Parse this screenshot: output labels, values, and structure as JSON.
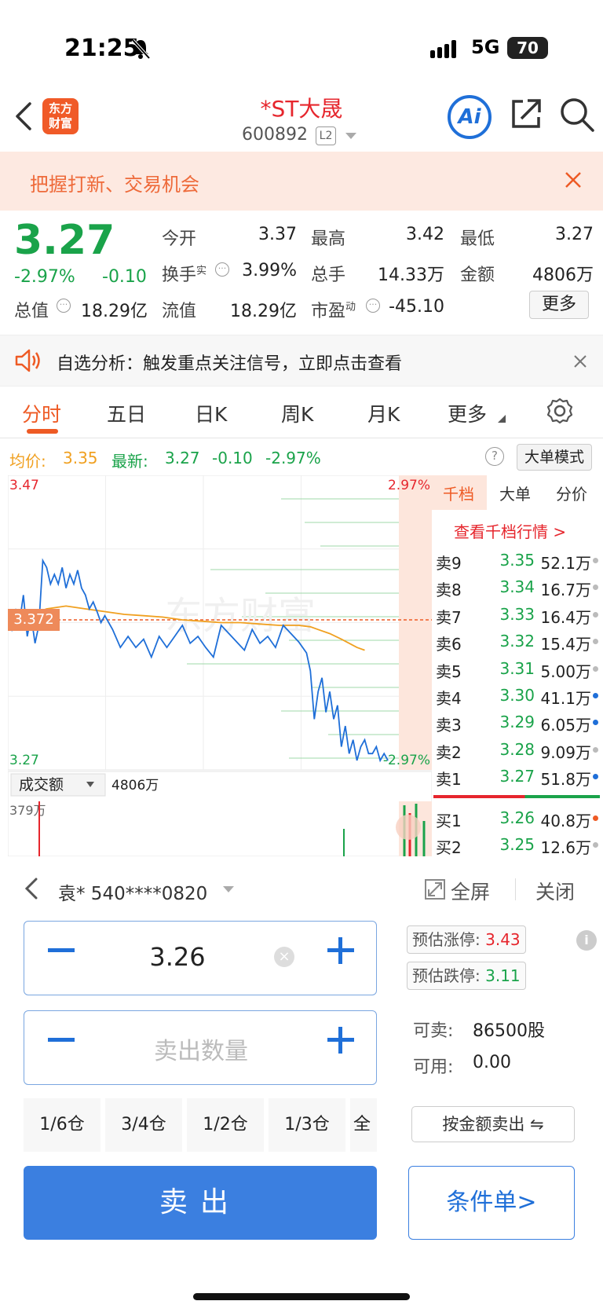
{
  "status": {
    "time": "21:25",
    "network": "5G",
    "battery": "70"
  },
  "header": {
    "logo": "东方\n财富",
    "title": "*ST大晟",
    "code": "600892",
    "level": "L2",
    "ai": "Ai"
  },
  "banner": {
    "text": "把握打新、交易机会"
  },
  "quote": {
    "price": "3.27",
    "pct": "-2.97%",
    "chg": "-0.10",
    "open_label": "今开",
    "open": "3.37",
    "high_label": "最高",
    "high": "3.42",
    "low_label": "最低",
    "low": "3.27",
    "turnover_label": "换手",
    "turnover_sup": "实",
    "turnover": "3.99%",
    "volume_label": "总手",
    "volume": "14.33万",
    "amount_label": "金额",
    "amount": "4806万",
    "mktcap_label": "总值",
    "mktcap": "18.29亿",
    "float_label": "流值",
    "float": "18.29亿",
    "pe_label": "市盈",
    "pe_sup": "动",
    "pe": "-45.10",
    "more": "更多"
  },
  "alert": {
    "text": "自选分析：触发重点关注信号，立即点击查看"
  },
  "tabs": [
    "分时",
    "五日",
    "日K",
    "周K",
    "月K",
    "更多"
  ],
  "chart_info": {
    "avg_label": "均价:",
    "avg": "3.35",
    "last_label": "最新:",
    "last": "3.27",
    "chg": "-0.10",
    "pct": "-2.97%",
    "mode": "大单模式"
  },
  "chart_data": {
    "type": "line",
    "y_top": "3.47",
    "y_bottom": "3.27",
    "pct_top": "2.97%",
    "pct_bottom": "-2.97%",
    "ylim": [
      3.27,
      3.47
    ],
    "ref_price": "3.372",
    "series": [],
    "price_x": [
      0,
      0.01,
      0.02,
      0.03,
      0.04,
      0.05,
      0.06,
      0.07,
      0.08,
      0.09,
      0.1,
      0.11,
      0.12,
      0.13,
      0.14,
      0.15,
      0.16,
      0.17,
      0.18,
      0.19,
      0.2,
      0.21,
      0.22,
      0.23,
      0.24,
      0.25,
      0.27,
      0.29,
      0.31,
      0.33,
      0.35,
      0.37,
      0.39,
      0.41,
      0.43,
      0.45,
      0.47,
      0.49,
      0.51,
      0.53,
      0.55,
      0.57,
      0.59,
      0.61,
      0.63,
      0.65,
      0.67,
      0.69,
      0.71,
      0.73,
      0.75,
      0.77,
      0.78,
      0.79,
      0.8,
      0.81,
      0.82,
      0.83,
      0.84,
      0.85,
      0.86,
      0.87,
      0.88,
      0.89,
      0.9,
      0.91,
      0.92,
      0.93,
      0.94,
      0.95,
      0.96,
      0.97,
      0.98
    ],
    "price_y": [
      3.372,
      3.365,
      3.38,
      3.37,
      3.39,
      3.36,
      3.375,
      3.355,
      3.368,
      3.415,
      3.41,
      3.398,
      3.405,
      3.398,
      3.41,
      3.395,
      3.405,
      3.398,
      3.408,
      3.395,
      3.39,
      3.38,
      3.385,
      3.378,
      3.37,
      3.375,
      3.365,
      3.352,
      3.36,
      3.352,
      3.358,
      3.345,
      3.36,
      3.352,
      3.36,
      3.368,
      3.355,
      3.36,
      3.352,
      3.345,
      3.368,
      3.362,
      3.356,
      3.35,
      3.365,
      3.355,
      3.36,
      3.352,
      3.368,
      3.362,
      3.356,
      3.348,
      3.335,
      3.3,
      3.32,
      3.33,
      3.305,
      3.32,
      3.3,
      3.31,
      3.28,
      3.295,
      3.275,
      3.285,
      3.27,
      3.28,
      3.285,
      3.275,
      3.275,
      3.28,
      3.27,
      3.275,
      3.27
    ],
    "avg_x": [
      0,
      0.05,
      0.1,
      0.15,
      0.2,
      0.25,
      0.3,
      0.35,
      0.4,
      0.45,
      0.5,
      0.55,
      0.6,
      0.65,
      0.7,
      0.75,
      0.78,
      0.8,
      0.83,
      0.86,
      0.88,
      0.9,
      0.92
    ],
    "avg_y": [
      3.37,
      3.375,
      3.38,
      3.382,
      3.38,
      3.378,
      3.376,
      3.375,
      3.374,
      3.372,
      3.371,
      3.37,
      3.37,
      3.369,
      3.368,
      3.368,
      3.367,
      3.365,
      3.362,
      3.358,
      3.355,
      3.352,
      3.35
    ],
    "volume_label": "成交额",
    "volume_value": "4806万",
    "volume_max": "379万"
  },
  "book": {
    "tabs": [
      "千档",
      "大单",
      "分价"
    ],
    "link": "查看千档行情 >",
    "asks": [
      {
        "label": "卖9",
        "price": "3.35",
        "vol": "52.1万",
        "dot": "#bbbbbb"
      },
      {
        "label": "卖8",
        "price": "3.34",
        "vol": "16.7万",
        "dot": "#bbbbbb"
      },
      {
        "label": "卖7",
        "price": "3.33",
        "vol": "16.4万",
        "dot": "#bbbbbb"
      },
      {
        "label": "卖6",
        "price": "3.32",
        "vol": "15.4万",
        "dot": "#bbbbbb"
      },
      {
        "label": "卖5",
        "price": "3.31",
        "vol": "5.00万",
        "dot": "#bbbbbb"
      },
      {
        "label": "卖4",
        "price": "3.30",
        "vol": "41.1万",
        "dot": "#1f6fd8"
      },
      {
        "label": "卖3",
        "price": "3.29",
        "vol": "6.05万",
        "dot": "#1f6fd8"
      },
      {
        "label": "卖2",
        "price": "3.28",
        "vol": "9.09万",
        "dot": "#bbbbbb"
      },
      {
        "label": "卖1",
        "price": "3.27",
        "vol": "51.8万",
        "dot": "#1f6fd8"
      }
    ],
    "bids": [
      {
        "label": "买1",
        "price": "3.26",
        "vol": "40.8万",
        "dot": "#ee5a24"
      },
      {
        "label": "买2",
        "price": "3.25",
        "vol": "12.6万",
        "dot": "#bbbbbb"
      }
    ]
  },
  "trade": {
    "account": "袁* 540****0820",
    "fullscreen": "全屏",
    "close": "关闭",
    "price": "3.26",
    "qty_placeholder": "卖出数量",
    "limit_up_label": "预估涨停:",
    "limit_up": "3.43",
    "limit_down_label": "预估跌停:",
    "limit_down": "3.11",
    "sellable_label": "可卖:",
    "sellable": "86500股",
    "avail_label": "可用:",
    "avail": "0.00",
    "by_amount": "按金额卖出 ⇋",
    "positions": [
      "1/6仓",
      "3/4仓",
      "1/2仓",
      "1/3仓",
      "全"
    ],
    "sell": "卖出",
    "cond": "条件单>"
  }
}
